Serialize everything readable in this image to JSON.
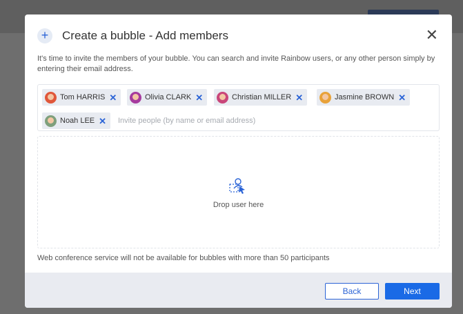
{
  "dialog": {
    "title": "Create a bubble - Add members",
    "plus_symbol": "+",
    "close_symbol": "✕",
    "description": "It's time to invite the members of your bubble. You can search and invite Rainbow users, or any other person simply by entering their email address."
  },
  "members": [
    {
      "name": "Tom HARRIS",
      "remove": "✕",
      "avatar_color": "#e0573a"
    },
    {
      "name": "Olivia CLARK",
      "remove": "✕",
      "avatar_color": "#a63b9e"
    },
    {
      "name": "Christian MILLER",
      "remove": "✕",
      "avatar_color": "#c9467a"
    },
    {
      "name": "Jasmine BROWN",
      "remove": "✕",
      "avatar_color": "#e8a23a"
    },
    {
      "name": "Noah LEE",
      "remove": "✕",
      "avatar_color": "#7fa07c"
    }
  ],
  "invite": {
    "placeholder": "Invite people (by name or email address)",
    "value": ""
  },
  "dropzone": {
    "label": "Drop user here",
    "icon": "drop-user-icon"
  },
  "note": "Web conference service will not be available for bubbles with more than 50 participants",
  "footer": {
    "back_label": "Back",
    "next_label": "Next"
  },
  "colors": {
    "accent": "#1a6ae6",
    "footer_bg": "#e9ebf1",
    "chip_bg": "#e8ebf1"
  }
}
